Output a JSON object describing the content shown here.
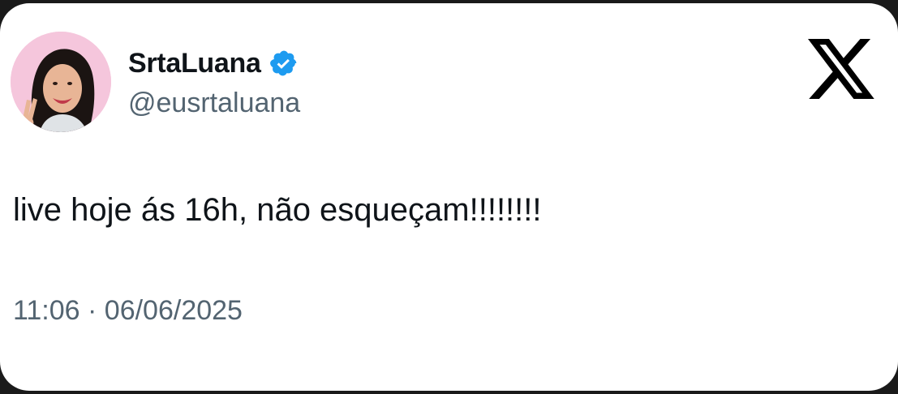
{
  "author": {
    "display_name": "SrtaLuana",
    "handle": "@eusrtaluana",
    "verified": true,
    "avatar_icon": "user-avatar-photo"
  },
  "tweet": {
    "text": "live hoje ás 16h, não esqueçam!!!!!!!!",
    "time": "11:06",
    "separator": "·",
    "date": "06/06/2025"
  },
  "brand": {
    "logo": "x-logo-icon",
    "verified_color": "#1d9bf0"
  }
}
